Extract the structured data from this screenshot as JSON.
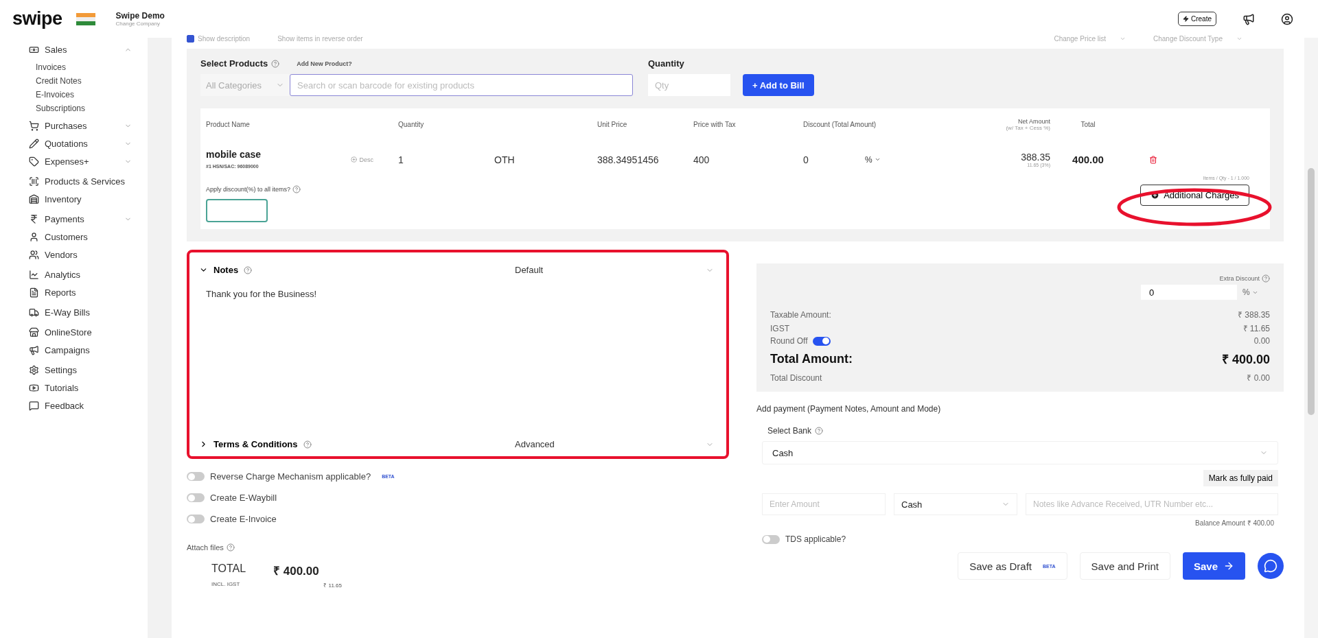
{
  "header": {
    "logo": "swipe",
    "company": "Swipe Demo",
    "company_sub": "Change Company",
    "create_button": "Create"
  },
  "sidebar": {
    "groups": [
      [
        {
          "label": "Sales",
          "kind": "menu",
          "expanded": true,
          "children": [
            "Invoices",
            "Credit Notes",
            "E-Invoices",
            "Subscriptions"
          ]
        },
        {
          "label": "Purchases",
          "kind": "menu",
          "expanded": false
        },
        {
          "label": "Quotations",
          "kind": "menu",
          "expanded": false
        },
        {
          "label": "Expenses+",
          "kind": "menu",
          "expanded": false
        }
      ],
      [
        {
          "label": "Products & Services",
          "kind": "link"
        },
        {
          "label": "Inventory",
          "kind": "link"
        }
      ],
      [
        {
          "label": "Payments",
          "kind": "menu",
          "expanded": false
        },
        {
          "label": "Customers",
          "kind": "link"
        },
        {
          "label": "Vendors",
          "kind": "link"
        }
      ],
      [
        {
          "label": "Analytics",
          "kind": "link"
        },
        {
          "label": "Reports",
          "kind": "link"
        }
      ],
      [
        {
          "label": "E-Way Bills",
          "kind": "link"
        }
      ],
      [
        {
          "label": "OnlineStore",
          "kind": "link"
        },
        {
          "label": "Campaigns",
          "kind": "link"
        }
      ],
      [
        {
          "label": "Settings",
          "kind": "link"
        },
        {
          "label": "Tutorials",
          "kind": "link"
        },
        {
          "label": "Feedback",
          "kind": "link"
        }
      ]
    ]
  },
  "options_row": {
    "checks": [
      {
        "label": "Show description",
        "checked": true
      },
      {
        "label": "Show items in reverse order",
        "checked": false
      }
    ],
    "selects": [
      "Change Price list",
      "Change Discount Type"
    ]
  },
  "product_picker": {
    "label": "Select Products",
    "add_link": "Add New Product?",
    "category": "All Categories",
    "search_placeholder": "Search or scan barcode for existing products",
    "quantity_label": "Quantity",
    "quantity_placeholder": "Qty",
    "add_button": "+ Add to Bill"
  },
  "table": {
    "columns": [
      {
        "label": "Product Name"
      },
      {
        "label": "Quantity"
      },
      {
        "label": "Unit Price"
      },
      {
        "label": "Price with Tax"
      },
      {
        "label": "Discount (Total Amount)"
      },
      {
        "label": "Net Amount",
        "sub": "(w/ Tax + Cess %)"
      },
      {
        "label": "Total"
      }
    ],
    "rows": [
      {
        "name": "mobile case",
        "code": "#1 HSN/SAC: 96089000",
        "desc_button": "Desc",
        "quantity": "1",
        "unit": "OTH",
        "unit_price": "388.34951456",
        "price_with_tax": "400",
        "discount": "0",
        "discount_type": "%",
        "net_amount": "388.35",
        "tax": "11.65 (3%)",
        "total": "400.00"
      }
    ],
    "items_summary": "Items / Qty - 1 / 1.000",
    "apply_discount_label": "Apply discount(%) to all items?",
    "additional_charges": "Additional Charges"
  },
  "notes": {
    "title": "Notes",
    "template": "Default",
    "text": "Thank you for the Business!",
    "expanded": true
  },
  "terms": {
    "title": "Terms & Conditions",
    "template": "Advanced",
    "expanded": false
  },
  "toggles": [
    {
      "label": "Reverse Charge Mechanism applicable?",
      "on": false,
      "badge": "BETA"
    },
    {
      "label": "Create E-Waybill",
      "on": false
    },
    {
      "label": "Create E-Invoice",
      "on": false
    }
  ],
  "attach_files": "Attach files",
  "footer_total": {
    "label": "TOTAL",
    "amount": "₹ 400.00",
    "tax_label": "INCL. IGST",
    "tax_amount": "₹ 11.65"
  },
  "summary": {
    "extra_discount_label": "Extra Discount",
    "extra_discount": "0",
    "extra_discount_type": "%",
    "lines": [
      {
        "label": "Taxable Amount:",
        "value": "₹ 388.35"
      },
      {
        "label": "IGST",
        "value": "₹ 11.65"
      }
    ],
    "round_off": {
      "label": "Round Off",
      "on": true,
      "value": "0.00"
    },
    "total_label": "Total Amount:",
    "total": "₹ 400.00",
    "discount_label": "Total Discount",
    "discount": "₹ 0.00"
  },
  "payment": {
    "heading": "Add payment (Payment Notes, Amount and Mode)",
    "bank_label": "Select Bank",
    "bank": "Cash",
    "mark_paid": "Mark as fully paid",
    "amount_placeholder": "Enter Amount",
    "mode": "Cash",
    "notes_placeholder": "Notes like Advance Received, UTR Number etc...",
    "balance": "Balance Amount  ₹ 400.00",
    "tds": {
      "label": "TDS applicable?",
      "on": false
    }
  },
  "actions": [
    {
      "label": "Save as Draft",
      "kind": "secondary",
      "badge": "BETA"
    },
    {
      "label": "Save and Print",
      "kind": "secondary"
    },
    {
      "label": "Save",
      "kind": "primary"
    }
  ]
}
